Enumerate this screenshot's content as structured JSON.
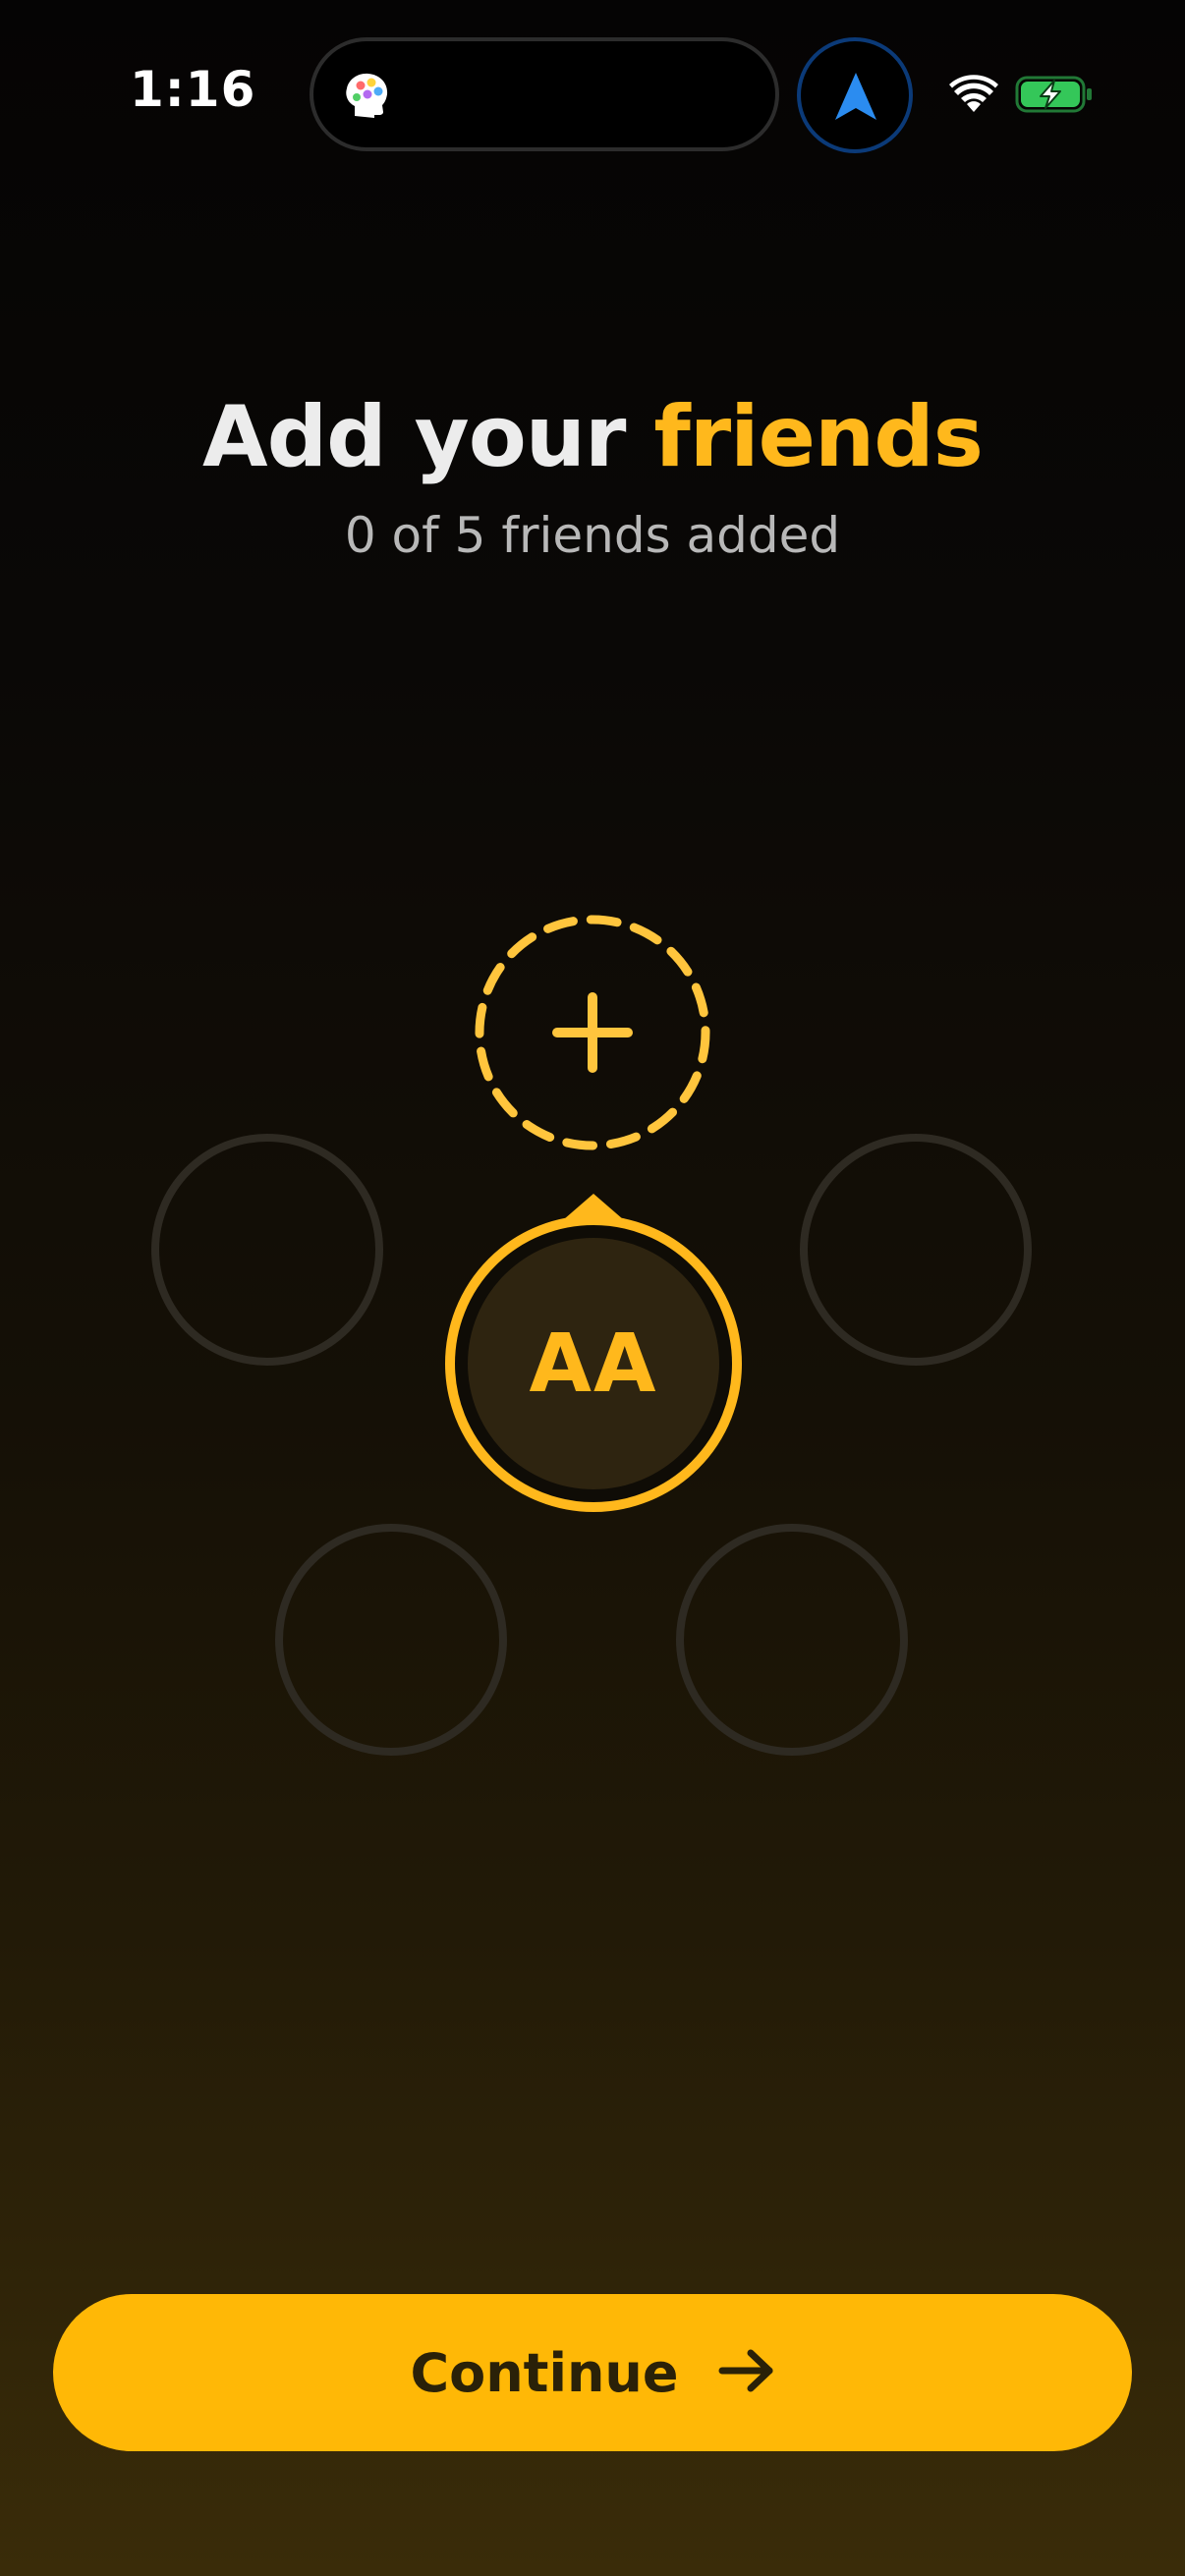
{
  "status_bar": {
    "time": "1:16",
    "icons": [
      "brain-app-icon",
      "navigation-arrow-icon",
      "wifi-icon",
      "battery-charging-icon"
    ],
    "battery_color": "#34c759",
    "nav_color": "#2b8cf0"
  },
  "header": {
    "title_prefix": "Add your ",
    "title_accent": "friends",
    "subtitle": "0 of 5 friends added"
  },
  "friends": {
    "added": 0,
    "max": 5,
    "self_initials": "AA",
    "add_icon": "plus-icon"
  },
  "continue_button": {
    "label": "Continue",
    "icon": "arrow-right-icon"
  },
  "colors": {
    "accent": "#ffb81c",
    "button_bg": "#ffb806",
    "button_text": "#2a2108"
  }
}
